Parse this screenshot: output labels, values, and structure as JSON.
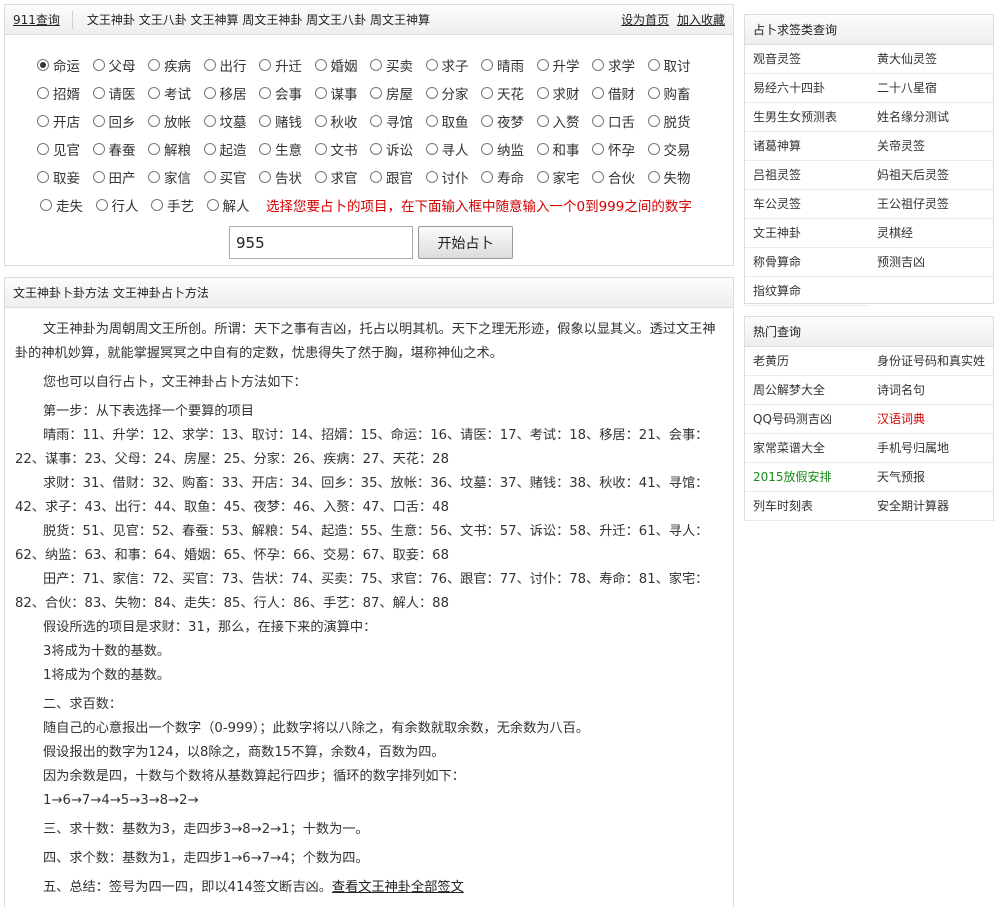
{
  "header": {
    "home_link": "911查询",
    "title": "文王神卦 文王八卦 文王神算 周文王神卦 周文王八卦 周文王神算",
    "set_home": "设为首页",
    "add_fav": "加入收藏"
  },
  "options": {
    "row1": [
      "命运",
      "父母",
      "疾病",
      "出行",
      "升迁",
      "婚姻",
      "买卖",
      "求子",
      "晴雨",
      "升学",
      "求学",
      "取讨"
    ],
    "row2": [
      "招婿",
      "请医",
      "考试",
      "移居",
      "会事",
      "谋事",
      "房屋",
      "分家",
      "天花",
      "求财",
      "借财",
      "购畜"
    ],
    "row3": [
      "开店",
      "回乡",
      "放帐",
      "坟墓",
      "赌钱",
      "秋收",
      "寻馆",
      "取鱼",
      "夜梦",
      "入赘",
      "口舌",
      "脱货"
    ],
    "row4": [
      "见官",
      "春蚕",
      "解粮",
      "起造",
      "生意",
      "文书",
      "诉讼",
      "寻人",
      "纳监",
      "和事",
      "怀孕",
      "交易"
    ],
    "row5": [
      "取妾",
      "田产",
      "家信",
      "买官",
      "告状",
      "求官",
      "跟官",
      "讨仆",
      "寿命",
      "家宅",
      "合伙",
      "失物"
    ],
    "row6": [
      "走失",
      "行人",
      "手艺",
      "解人"
    ],
    "selected": "命运",
    "hint": "选择您要占卜的项目，在下面输入框中随意输入一个0到999之间的数字"
  },
  "form": {
    "number_value": "955",
    "start_label": "开始占卜"
  },
  "main": {
    "title": "文王神卦卜卦方法 文王神卦占卜方法",
    "p1": "文王神卦为周朝周文王所创。所谓：天下之事有吉凶，托占以明其机。天下之理无形迹，假象以显其义。透过文王神卦的神机妙算，就能掌握冥冥之中自有的定数，忧患得失了然于胸，堪称神仙之术。",
    "p2": "您也可以自行占卜，文王神卦占卜方法如下：",
    "step1": "第一步：从下表选择一个要算的项目",
    "list1": "晴雨：11、升学：12、求学：13、取讨：14、招婿：15、命运：16、请医：17、考试：18、移居：21、会事：22、谋事：23、父母：24、房屋：25、分家：26、疾病：27、天花：28",
    "list2": "求财：31、借财：32、购畜：33、开店：34、回乡：35、放帐：36、坟墓：37、赌钱：38、秋收：41、寻馆：42、求子：43、出行：44、取鱼：45、夜梦：46、入赘：47、口舌：48",
    "list3": "脱货：51、见官：52、春蚕：53、解粮：54、起造：55、生意：56、文书：57、诉讼：58、升迁：61、寻人：62、纳监：63、和事：64、婚姻：65、怀孕：66、交易：67、取妾：68",
    "list4": "田产：71、家信：72、买官：73、告状：74、买卖：75、求官：76、跟官：77、讨仆：78、寿命：81、家宅：82、合伙：83、失物：84、走失：85、行人：86、手艺：87、解人：88",
    "assume": "假设所选的项目是求财：31，那么，在接下来的演算中：",
    "base10": "3将成为十数的基数。",
    "base1": "1将成为个数的基数。",
    "step2_title": "二、求百数：",
    "step2_a": "随自己的心意报出一个数字（0-999）；此数字将以八除之，有余数就取余数，无余数为八百。",
    "step2_b": "假设报出的数字为124，以8除之，商数15不算，余数4，百数为四。",
    "step2_c": "因为余数是四，十数与个数将从基数算起行四步；循环的数字排列如下：",
    "step2_d": "1→6→7→4→5→3→8→2→",
    "step3": "三、求十数：基数为3，走四步3→8→2→1；十数为一。",
    "step4": "四、求个数：基数为1，走四步1→6→7→4；个数为四。",
    "step5": "五、总结：签号为四一四，即以414签文断吉凶。",
    "view_all": "查看文王神卦全部签文"
  },
  "sidebar1": {
    "title": "占卜求签类查询",
    "items": [
      "观音灵签",
      "黄大仙灵签",
      "易经六十四卦",
      "二十八星宿",
      "生男生女预测表",
      "姓名缘分测试",
      "诸葛神算",
      "关帝灵签",
      "吕祖灵签",
      "妈祖天后灵签",
      "车公灵签",
      "王公祖仔灵签",
      "文王神卦",
      "灵棋经",
      "称骨算命",
      "预测吉凶",
      "指纹算命"
    ]
  },
  "sidebar2": {
    "title": "热门查询",
    "items": [
      "老黄历",
      "身份证号码和真实姓",
      "周公解梦大全",
      "诗词名句",
      "QQ号码测吉凶",
      "汉语词典",
      "家常菜谱大全",
      "手机号归属地",
      "2015放假安排",
      "天气预报",
      "列车时刻表",
      "安全期计算器"
    ],
    "colors": {
      "red": "#d40000",
      "green": "#1a8a1a"
    }
  }
}
